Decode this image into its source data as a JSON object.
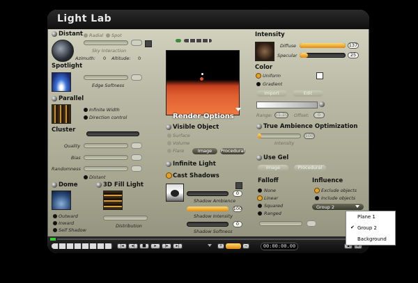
{
  "window": {
    "title": "Light Lab"
  },
  "distant": {
    "header": "Distant",
    "radial": "Radial",
    "spot": "Spot",
    "sky_interaction": "Sky Interaction",
    "azimuth_label": "Azimuth:",
    "azimuth": "0",
    "altitude_label": "Altitude:",
    "altitude": "0"
  },
  "spotlight": {
    "header": "Spotlight",
    "edge_softness": "Edge Softness"
  },
  "parallel": {
    "header": "Parallel",
    "infinite_width": "Infinite Width",
    "direction_control": "Direction control"
  },
  "cluster": {
    "header": "Cluster",
    "quality": "Quality",
    "bias": "Bias",
    "randomness": "Randomness",
    "distant": "Distant"
  },
  "dome": {
    "header": "Dome",
    "outward": "Outward",
    "inward": "Inward",
    "self_shadow": "Self Shadow"
  },
  "fill3d": {
    "header": "3D Fill Light",
    "distribution": "Distribution"
  },
  "render_options": {
    "title": "Render Options",
    "visible_object": "Visible Object",
    "surface": "Surface",
    "volume": "Volume",
    "flare": "Flare",
    "image_btn": "Image",
    "procedural_btn": "Procedural",
    "infinite_light": "Infinite Light",
    "cast_shadows": "Cast Shadows",
    "shadow_ambience": "Shadow Ambience",
    "shadow_ambience_value": "0",
    "shadow_intensity": "Shadow Intensity",
    "shadow_intensity_value": "100",
    "shadow_softness": "Shadow Softness",
    "shadow_softness_value": "0"
  },
  "intensity": {
    "header": "Intensity",
    "diffuse": "Diffuse",
    "diffuse_value": "137",
    "specular": "Specular",
    "specular_value": "25"
  },
  "color": {
    "header": "Color",
    "uniform": "Uniform",
    "gradient": "Gradient",
    "import_btn": "Import",
    "edit_btn": "Edit",
    "range_label": "Range:",
    "range_value": "51.20",
    "offset_label": "Offset:",
    "offset_value": "0"
  },
  "ambience": {
    "header": "True Ambience Optimization",
    "intensity": "Intensity",
    "value": "100"
  },
  "gel": {
    "header": "Use Gel",
    "image_btn": "Image",
    "procedural_btn": "Procedural"
  },
  "falloff": {
    "header": "Falloff",
    "none": "None",
    "linear": "Linear",
    "squared": "Squared",
    "ranged": "Ranged"
  },
  "influence": {
    "header": "Influence",
    "exclude": "Exclude objects",
    "include": "Include objects",
    "selected": "Group 2"
  },
  "dropdown_menu": {
    "items": [
      "Plane 1",
      "Group 2",
      "Background"
    ],
    "checked": "Group 2"
  },
  "timeline": {
    "time": "00:00:00.00",
    "add": "+",
    "remove": "−"
  }
}
